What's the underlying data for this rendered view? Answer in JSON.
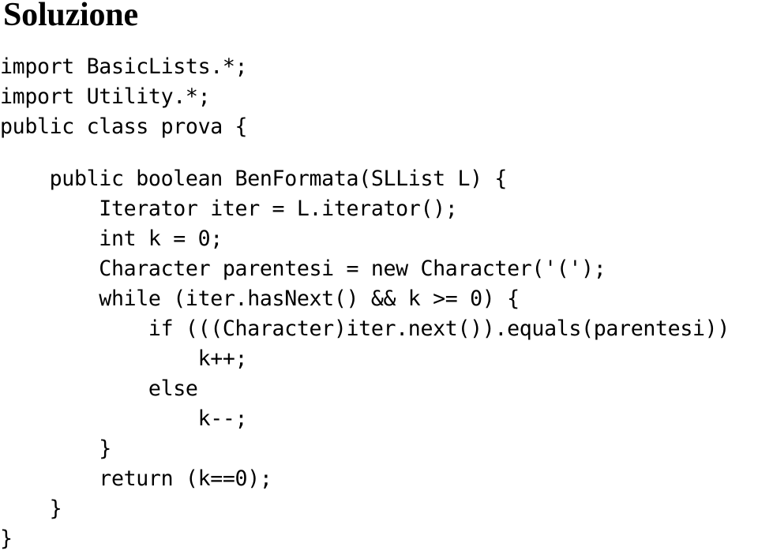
{
  "slide": {
    "title": "Soluzione",
    "background_color": "#ffffff",
    "text_color": "#000000",
    "language": "java"
  },
  "code": {
    "lines": [
      {
        "indent": 0,
        "text": "import BasicLists.*;"
      },
      {
        "indent": 0,
        "text": "import Utility.*;"
      },
      {
        "indent": 0,
        "text": "public class prova {"
      },
      {
        "indent": 0,
        "text": ""
      },
      {
        "indent": 4,
        "text": "public boolean BenFormata(SLList L) {"
      },
      {
        "indent": 8,
        "text": "Iterator iter = L.iterator();"
      },
      {
        "indent": 8,
        "text": "int k = 0;"
      },
      {
        "indent": 8,
        "text": "Character parentesi = new Character('(');"
      },
      {
        "indent": 8,
        "text": "while (iter.hasNext() && k >= 0) {"
      },
      {
        "indent": 12,
        "text": "if (((Character)iter.next()).equals(parentesi))"
      },
      {
        "indent": 16,
        "text": "k++;"
      },
      {
        "indent": 12,
        "text": "else"
      },
      {
        "indent": 16,
        "text": "k--;"
      },
      {
        "indent": 8,
        "text": "}"
      },
      {
        "indent": 8,
        "text": "return (k==0);"
      },
      {
        "indent": 4,
        "text": "}"
      },
      {
        "indent": 0,
        "text": "}"
      }
    ]
  }
}
